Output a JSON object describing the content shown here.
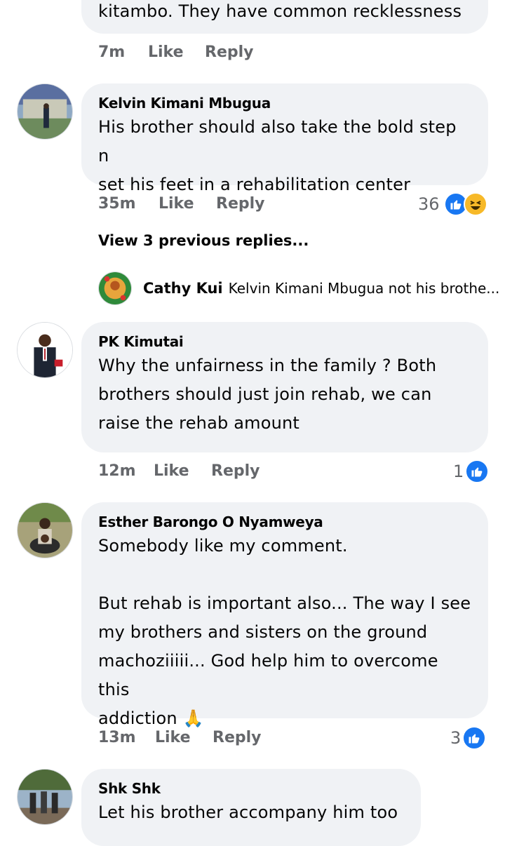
{
  "comments": [
    {
      "text": "kitambo. They have common recklessness",
      "time": "7m",
      "like": "Like",
      "reply": "Reply"
    },
    {
      "author": "Kelvin Kimani Mbugua",
      "text": "His brother should also take the bold step n\nset his feet in a rehabilitation center",
      "time": "35m",
      "like": "Like",
      "reply": "Reply",
      "reactions": "36"
    },
    {
      "author": "PK Kimutai",
      "text": "Why the unfairness in the family ? Both\nbrothers should just join rehab, we can\nraise the rehab amount",
      "time": "12m",
      "like": "Like",
      "reply": "Reply",
      "reactions": "1"
    },
    {
      "author": "Esther Barongo O Nyamweya",
      "text": "Somebody like my comment.\n\nBut rehab is important also... The way I see\nmy brothers and sisters on the ground\nmachoziiiii... God help him to overcome this\naddiction",
      "emoji": "🙏",
      "time": "13m",
      "like": "Like",
      "reply": "Reply",
      "reactions": "3"
    },
    {
      "author": "Shk Shk",
      "text": "Let his brother accompany him too"
    }
  ],
  "view_previous": "View 3 previous replies...",
  "nested_reply": {
    "author": "Cathy Kui",
    "text": "Kelvin Kimani Mbugua not his brothe..."
  },
  "colors": {
    "bubble": "#f0f2f5",
    "meta": "#65676b",
    "like_blue": "#1877f2",
    "haha_yellow": "#f7b928"
  },
  "icons": {
    "like": "like-reaction-icon",
    "haha": "haha-reaction-icon"
  }
}
